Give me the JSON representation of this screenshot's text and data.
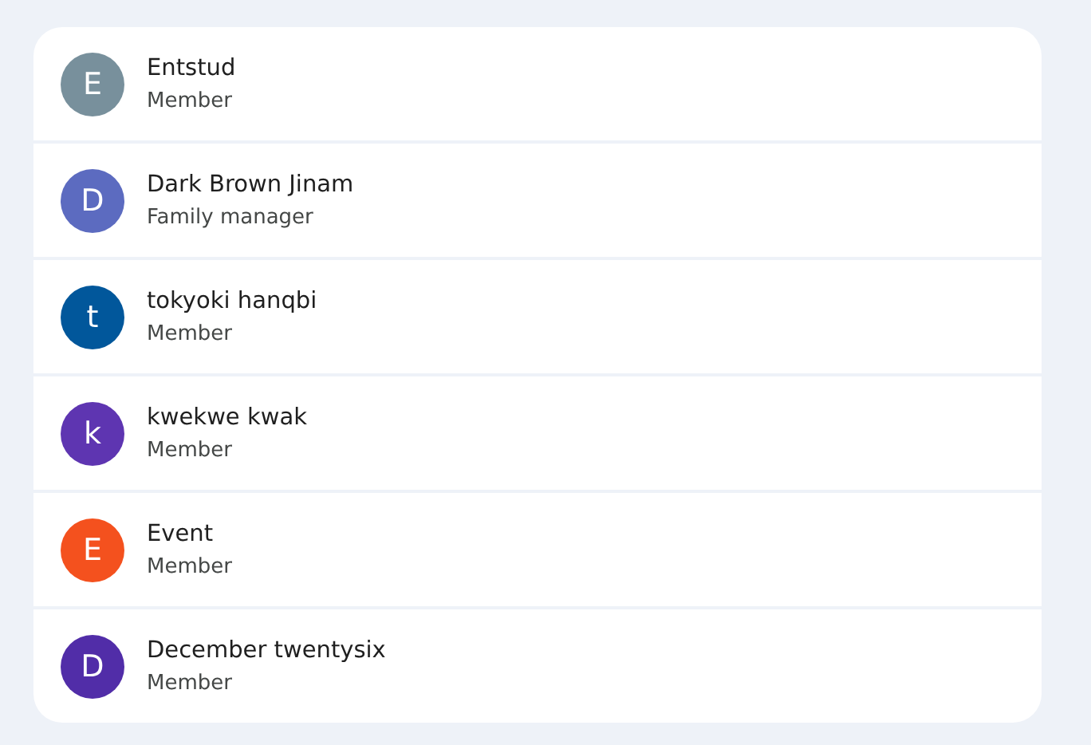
{
  "members": [
    {
      "initial": "E",
      "name": "Entstud",
      "role": "Member",
      "color": "#78909c"
    },
    {
      "initial": "D",
      "name": "Dark Brown Jinam",
      "role": "Family manager",
      "color": "#5c6bc0"
    },
    {
      "initial": "t",
      "name": "tokyoki hanqbi",
      "role": "Member",
      "color": "#01579b"
    },
    {
      "initial": "k",
      "name": "kwekwe kwak",
      "role": "Member",
      "color": "#5e35b1"
    },
    {
      "initial": "E",
      "name": "Event",
      "role": "Member",
      "color": "#f4511e"
    },
    {
      "initial": "D",
      "name": "December twentysix",
      "role": "Member",
      "color": "#512da8"
    }
  ]
}
